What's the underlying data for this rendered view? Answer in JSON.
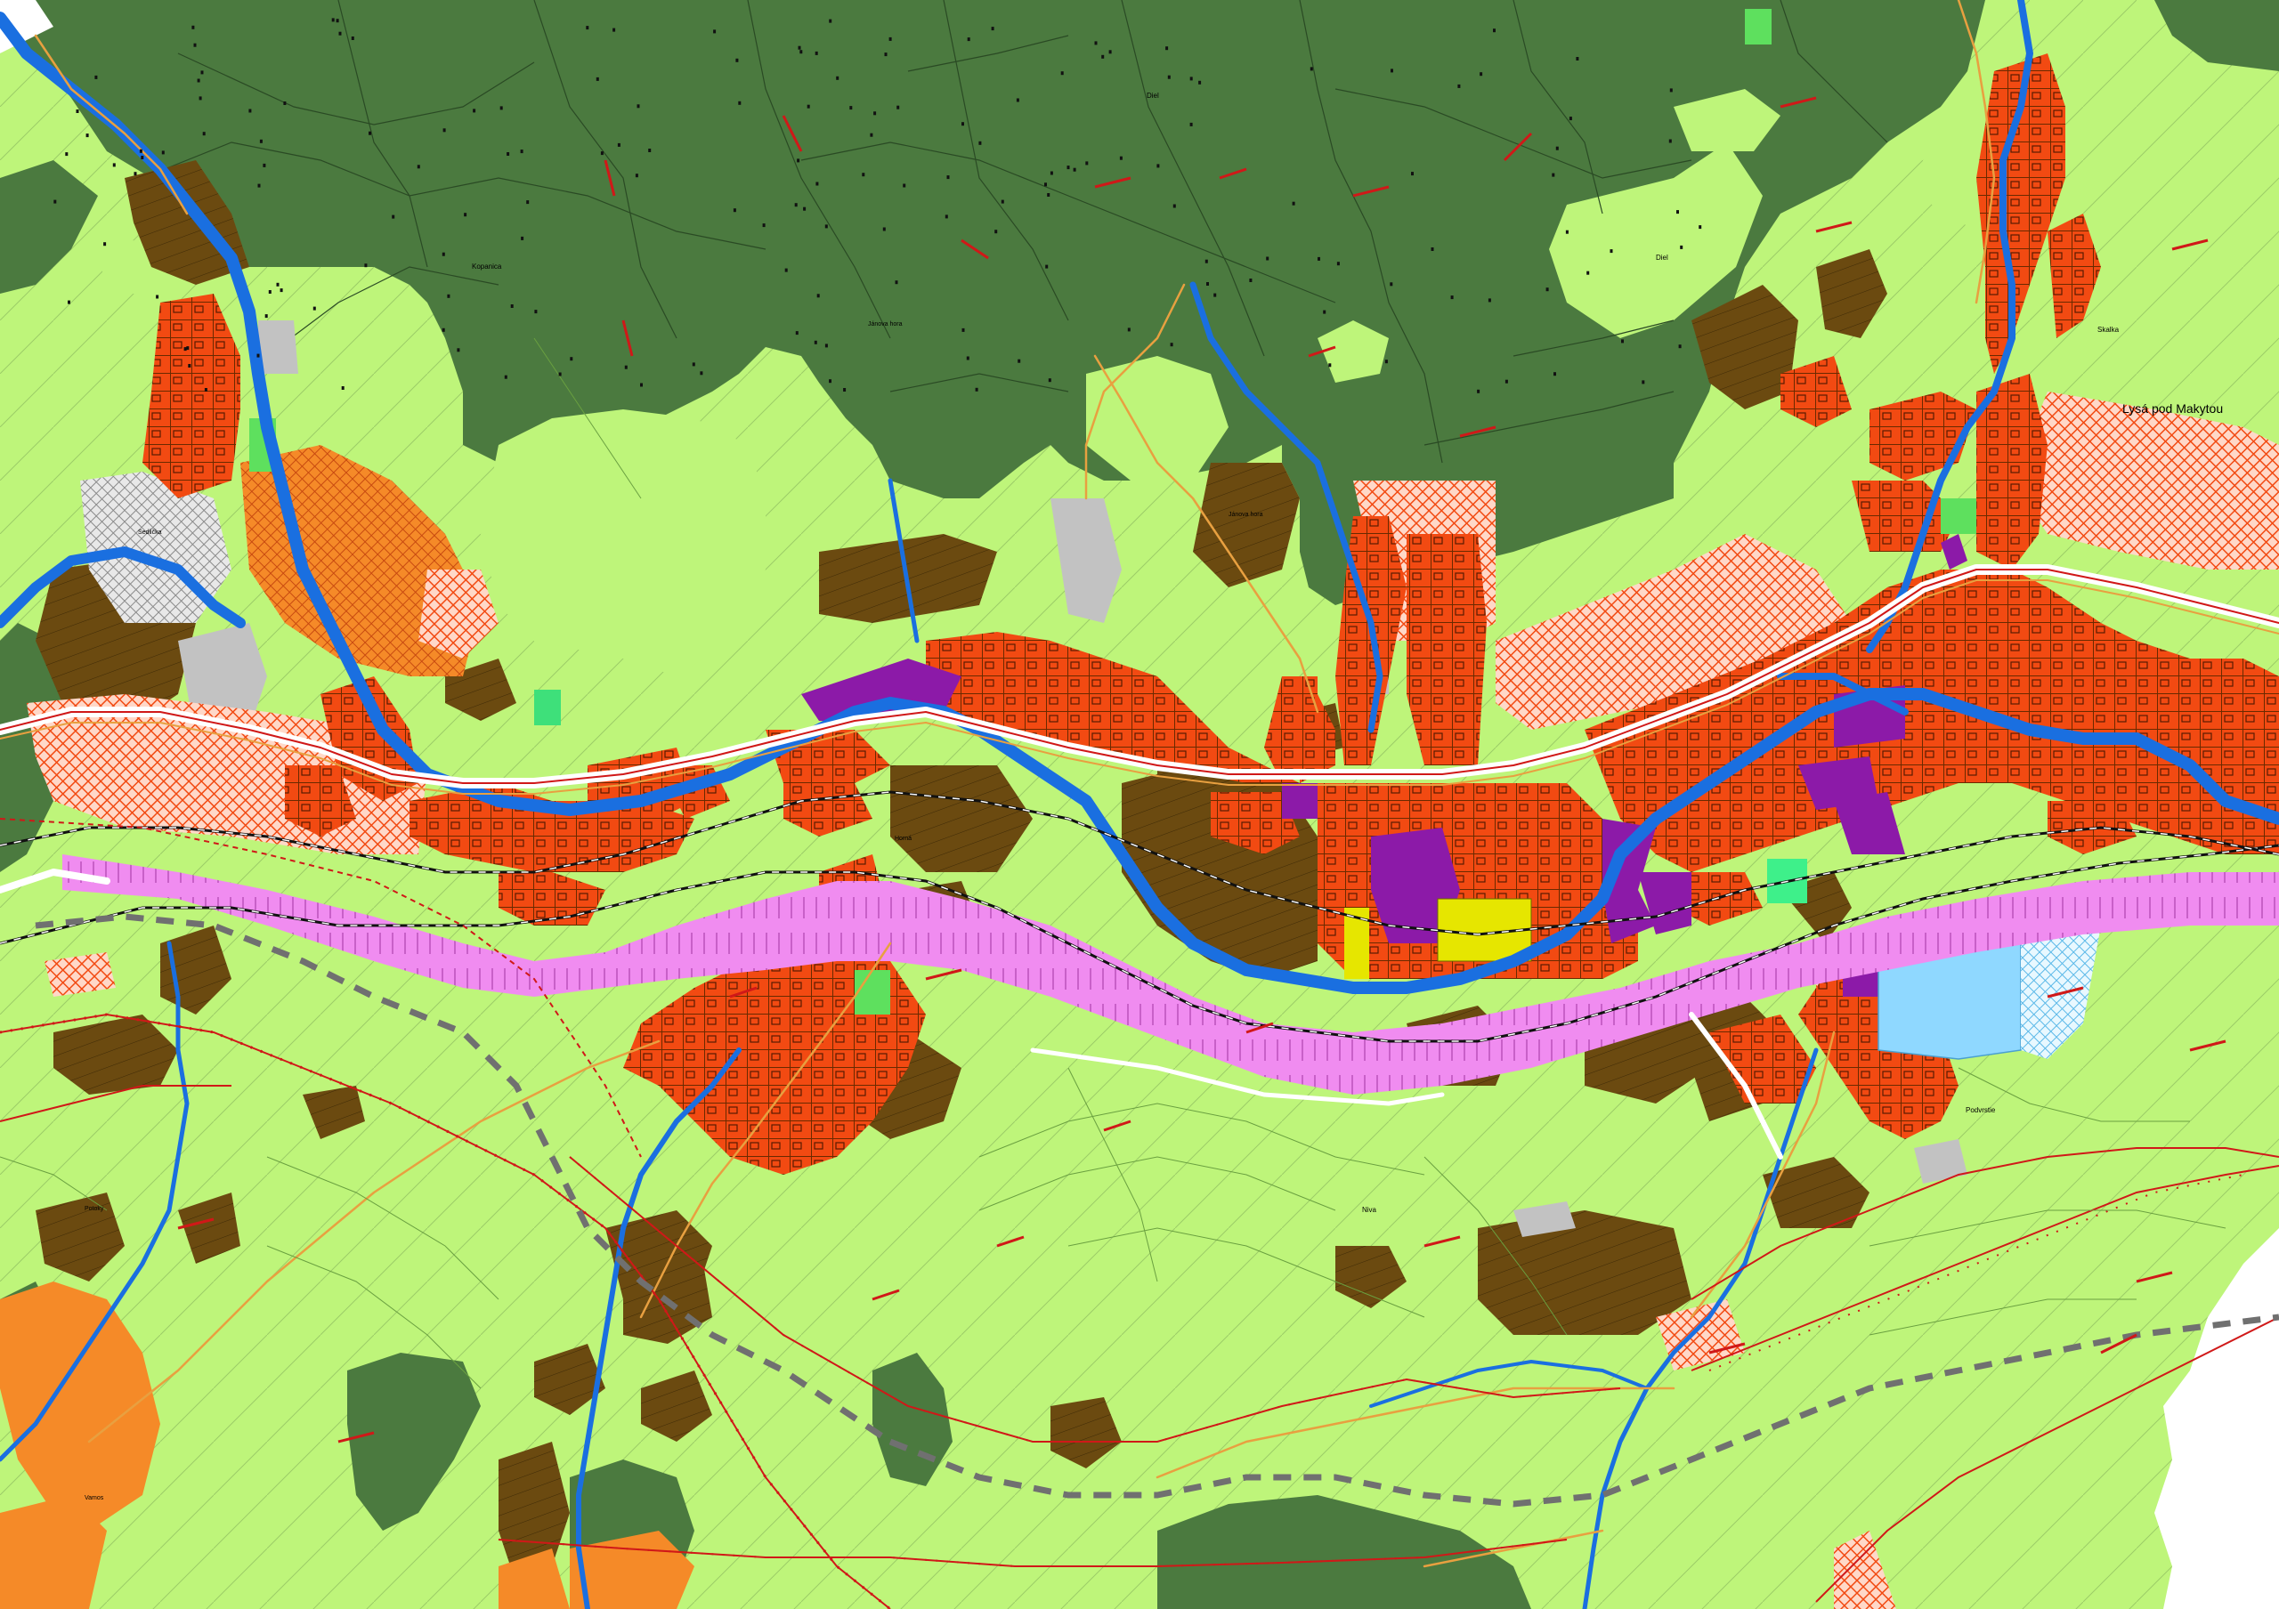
{
  "colors": {
    "forest": "#4b7a3f",
    "forest_dark": "#2f5a2b",
    "meadow": "#bef57a",
    "meadow_lines": "#8cbf5a",
    "arable": "#6b4a10",
    "residential": "#f24a12",
    "residential_hatch": "#ffd8c8",
    "garden_orange": "#f58a28",
    "industry": "#8c1aa8",
    "industry_yellow": "#e6e600",
    "water": "#1a6fe0",
    "water_area": "#8fd8ff",
    "railway_corridor": "#f08cf0",
    "grey_area": "#c2c2c2",
    "bright_green": "#5ee05e",
    "road": "#e8a040",
    "railway": "#111111",
    "planned_line": "#d01818",
    "planned_dash": "#707070"
  },
  "place_labels": {
    "lysa": "Lysá pod Makytou",
    "kopanica": "Kopanica",
    "jemova_hora_top": "Jánova hora",
    "jemova_hora": "Jánova hora",
    "diel_top": "Diel",
    "diel_right": "Diel",
    "skalka": "Skalka",
    "podvrstie": "Podvrstie",
    "niva": "Niva",
    "potoky": "Potoky",
    "vamos": "Vamos",
    "sedlicka": "Sedlička",
    "horna": "Horná"
  },
  "legend_icons": [
    "tree-symbol-icon"
  ]
}
